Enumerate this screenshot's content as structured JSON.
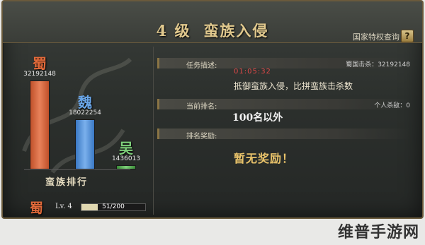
{
  "header": {
    "level": "4 级",
    "event_title": "蛮族入侵",
    "privilege_link": "国家特权查询",
    "help_label": "?"
  },
  "ranking": {
    "title": "蛮族排行",
    "kingdoms": [
      {
        "name": "蜀",
        "score": "32192148",
        "color": "#e26a3a"
      },
      {
        "name": "魏",
        "score": "18022254",
        "color": "#6aa6e8"
      },
      {
        "name": "吴",
        "score": "1436013",
        "color": "#7ed07a"
      }
    ]
  },
  "chart_data": {
    "type": "bar",
    "categories": [
      "蜀",
      "魏",
      "吴"
    ],
    "values": [
      32192148,
      18022254,
      1436013
    ],
    "title": "蛮族排行"
  },
  "footer": {
    "kingdom": "蜀",
    "level": "Lv. 4",
    "xp_text": "51/200",
    "xp_fraction": 0.255
  },
  "task": {
    "label": "任务描述:",
    "kill_count": "蜀国击杀：32192148",
    "timer": "01:05:32",
    "description": "抵御蛮族入侵，比拼蛮族击杀数"
  },
  "rank": {
    "label": "当前排名:",
    "personal_kills": "个人杀敌：0",
    "value": "100名以外"
  },
  "reward": {
    "label": "排名奖励:",
    "value": "暂无奖励！"
  },
  "watermark": "维普手游网"
}
